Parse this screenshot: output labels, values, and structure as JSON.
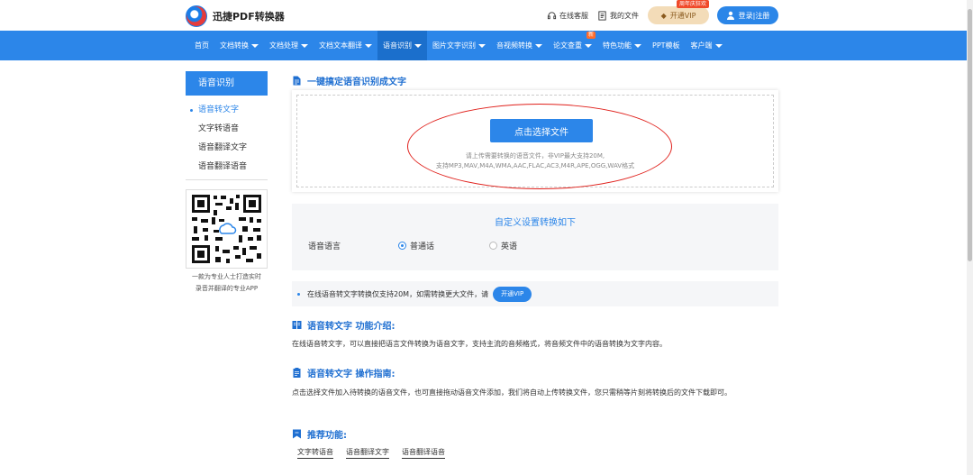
{
  "header": {
    "logo_text": "迅捷PDF转换器",
    "links": [
      {
        "label": "在线客服",
        "icon": "headset-icon"
      },
      {
        "label": "我的文件",
        "icon": "file-icon"
      }
    ],
    "vip_label": "开通VIP",
    "vip_tag": "周年庆狂欢",
    "login_label": "登录|注册"
  },
  "nav": {
    "items": [
      {
        "label": "首页",
        "caret": false
      },
      {
        "label": "文档转换",
        "caret": true
      },
      {
        "label": "文档处理",
        "caret": true
      },
      {
        "label": "文档文本翻译",
        "caret": true
      },
      {
        "label": "语音识别",
        "caret": true,
        "active": true
      },
      {
        "label": "图片文字识别",
        "caret": true
      },
      {
        "label": "音视频转换",
        "caret": true
      },
      {
        "label": "论文查重",
        "caret": true,
        "badge": "新"
      },
      {
        "label": "特色功能",
        "caret": true
      },
      {
        "label": "PPT模板",
        "caret": false
      },
      {
        "label": "客户端",
        "caret": true
      }
    ]
  },
  "sidebar": {
    "title": "语音识别",
    "items": [
      "语音转文字",
      "文字转语音",
      "语音翻译文字",
      "语音翻译语音"
    ],
    "qr_caption_line1": "一款为专业人士打造实时",
    "qr_caption_line2": "录音并翻译的专业APP"
  },
  "main": {
    "title": "一键搞定语音识别成文字",
    "choose_button": "点击选择文件",
    "upload_tip_line1": "请上传需要转换的语音文件，非VIP最大支持20M,",
    "upload_tip_line2": "支持MP3,MAV,M4A,WMA,AAC,FLAC,AC3,M4R,APE,OGG,WAV格式",
    "settings_title": "自定义设置转换如下",
    "settings_label": "语音语言",
    "options": [
      "普通话",
      "英语"
    ],
    "selected_option": "普通话",
    "notice": "在线语音转文字转换仅支持20M，如需转换更大文件，请",
    "notice_vip": "开通VIP",
    "intro_title": "语音转文字 功能介绍:",
    "intro_text": "在线语音转文字，可以直接把语言文件转换为语音文字，支持主流的音频格式，将音频文件中的语音转换为文字内容。",
    "guide_title": "语音转文字 操作指南:",
    "guide_text": "点击选择文件加入待转换的语音文件，也可直接拖动语音文件添加，我们将自动上传转换文件，您只需稍等片刻将转换后的文件下载即可。",
    "recommend_title": "推荐功能:",
    "recommend_links": [
      "文字转语音",
      "语音翻译文字",
      "语音翻译语音"
    ]
  },
  "colors": {
    "brand": "#2c86e9",
    "annotation": "#e0201b"
  }
}
